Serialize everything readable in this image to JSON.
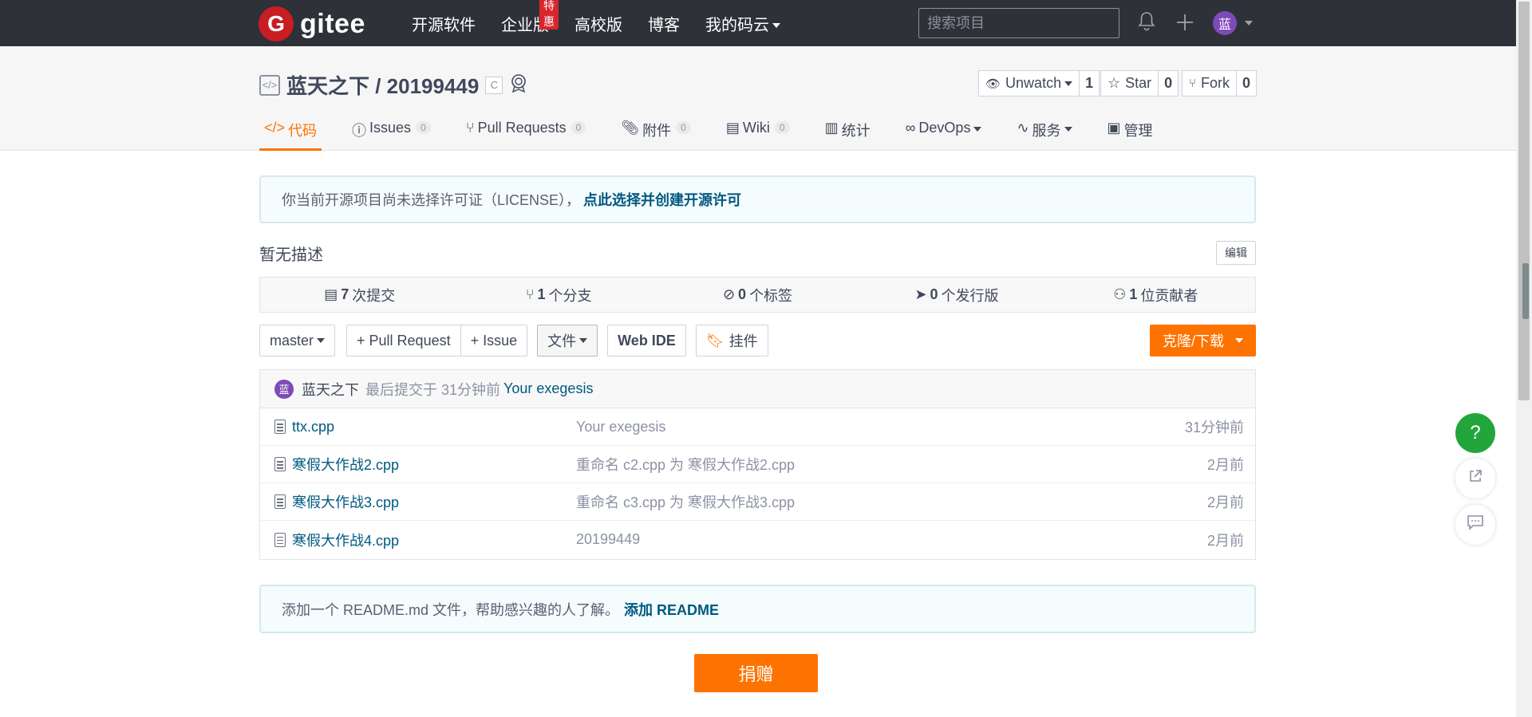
{
  "nav": {
    "logo_letter": "G",
    "logo_text": "gitee",
    "links": [
      "开源软件",
      "企业版",
      "高校版",
      "博客",
      "我的码云"
    ],
    "hot_badge": "特惠",
    "search_placeholder": "搜索项目",
    "avatar_text": "蓝"
  },
  "repo": {
    "title": "蓝天之下 / 20199449",
    "lang": "C",
    "unwatch_label": "Unwatch",
    "unwatch_count": "1",
    "star_label": "Star",
    "star_count": "0",
    "fork_label": "Fork",
    "fork_count": "0"
  },
  "tabs": [
    {
      "label": "代码",
      "count": ""
    },
    {
      "label": "Issues",
      "count": "0"
    },
    {
      "label": "Pull Requests",
      "count": "0"
    },
    {
      "label": "附件",
      "count": "0"
    },
    {
      "label": "Wiki",
      "count": "0"
    },
    {
      "label": "统计",
      "count": ""
    },
    {
      "label": "DevOps",
      "count": ""
    },
    {
      "label": "服务",
      "count": ""
    },
    {
      "label": "管理",
      "count": ""
    }
  ],
  "license": {
    "text": "你当前开源项目尚未选择许可证（LICENSE），",
    "link": "点此选择并创建开源许可"
  },
  "description": "暂无描述",
  "edit_label": "编辑",
  "stats": [
    {
      "num": "7",
      "label": "次提交"
    },
    {
      "num": "1",
      "label": "个分支"
    },
    {
      "num": "0",
      "label": "个标签"
    },
    {
      "num": "0",
      "label": "个发行版"
    },
    {
      "num": "1",
      "label": "位贡献者"
    }
  ],
  "toolbar": {
    "branch": "master",
    "pull_request": "+ Pull Request",
    "issue": "+ Issue",
    "file": "文件",
    "webide": "Web IDE",
    "widget": "挂件",
    "clone": "克隆/下载"
  },
  "commit": {
    "avatar": "蓝",
    "author": "蓝天之下",
    "time": "最后提交于 31分钟前",
    "message": "Your exegesis"
  },
  "files": [
    {
      "name": "ttx.cpp",
      "message": "Your exegesis",
      "time": "31分钟前"
    },
    {
      "name": "寒假大作战2.cpp",
      "message": "重命名 c2.cpp 为 寒假大作战2.cpp",
      "time": "2月前"
    },
    {
      "name": "寒假大作战3.cpp",
      "message": "重命名 c3.cpp 为 寒假大作战3.cpp",
      "time": "2月前"
    },
    {
      "name": "寒假大作战4.cpp",
      "message": "20199449",
      "time": "2月前"
    }
  ],
  "readme": {
    "text": "添加一个 README.md 文件，帮助感兴趣的人了解。",
    "link": "添加 README"
  },
  "donate": "捐赠",
  "help": "?",
  "colors": {
    "accent": "#fe7300",
    "nav_bg": "#2e3138",
    "link": "#005980",
    "help_green": "#22a53a"
  }
}
